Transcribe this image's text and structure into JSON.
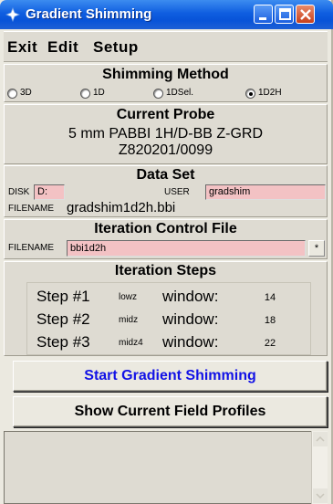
{
  "window": {
    "title": "Gradient Shimming",
    "title_icon": "app-icon",
    "controls": [
      "minimize-icon",
      "maximize-icon",
      "close-icon"
    ]
  },
  "menu": {
    "exit": "Exit",
    "edit": "Edit",
    "setup": "Setup"
  },
  "shimming_method": {
    "title": "Shimming Method",
    "options": [
      {
        "label": "3D",
        "selected": false
      },
      {
        "label": "1D",
        "selected": false
      },
      {
        "label": "1DSel.",
        "selected": false
      },
      {
        "label": "1D2H",
        "selected": true
      }
    ]
  },
  "current_probe": {
    "title": "Current Probe",
    "line1": "5 mm PABBI 1H/D-BB Z-GRD",
    "line2": "Z820201/0099"
  },
  "data_set": {
    "title": "Data Set",
    "disk_label": "DISK",
    "disk_value": "D:",
    "user_label": "USER",
    "user_value": "gradshim",
    "filename_label": "FILENAME",
    "filename_value": "gradshim1d2h.bbi"
  },
  "iteration_control_file": {
    "title": "Iteration Control File",
    "filename_label": "FILENAME",
    "filename_value": "bbi1d2h",
    "browse_label": "*"
  },
  "iteration_steps": {
    "title": "Iteration Steps",
    "steps": [
      {
        "name": "Step #1",
        "mode": "lowz",
        "window_label": "window:",
        "window_value": "14"
      },
      {
        "name": "Step #2",
        "mode": "midz",
        "window_label": "window:",
        "window_value": "18"
      },
      {
        "name": "Step #3",
        "mode": "midz4",
        "window_label": "window:",
        "window_value": "22"
      }
    ]
  },
  "buttons": {
    "start": "Start Gradient Shimming",
    "profiles": "Show Current Field Profiles"
  },
  "colors": {
    "titlebar": "#0f5ee0",
    "input_bg": "#f3c2c4",
    "start_text": "#1212e6",
    "panel_bg": "#dedbd2"
  }
}
